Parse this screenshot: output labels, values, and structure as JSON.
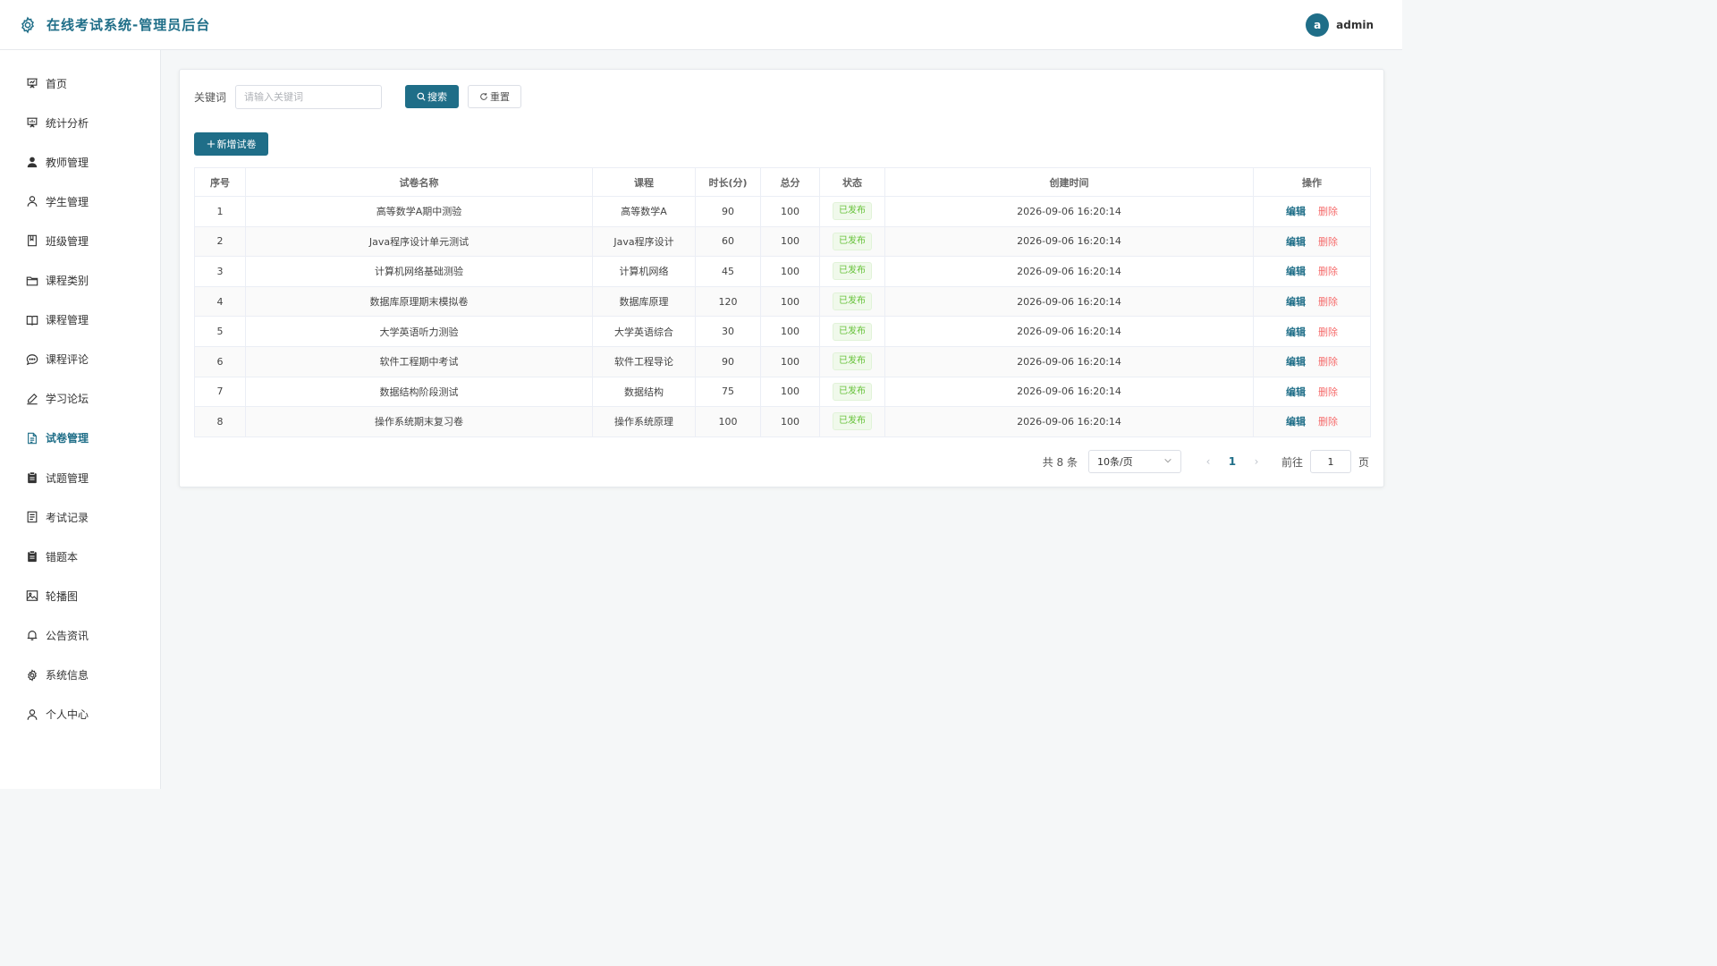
{
  "app": {
    "title": "在线考试系统-管理员后台"
  },
  "user": {
    "initial": "a",
    "name": "admin"
  },
  "sidebar": {
    "active": 9,
    "items": [
      {
        "label": "首页",
        "icon": "presentation-icon"
      },
      {
        "label": "统计分析",
        "icon": "chart-board-icon"
      },
      {
        "label": "教师管理",
        "icon": "user-filled-icon"
      },
      {
        "label": "学生管理",
        "icon": "user-icon"
      },
      {
        "label": "班级管理",
        "icon": "notebook-icon"
      },
      {
        "label": "课程类别",
        "icon": "folder-icon"
      },
      {
        "label": "课程管理",
        "icon": "book-icon"
      },
      {
        "label": "课程评论",
        "icon": "chat-icon"
      },
      {
        "label": "学习论坛",
        "icon": "edit-pen-icon"
      },
      {
        "label": "试卷管理",
        "icon": "document-icon"
      },
      {
        "label": "试题管理",
        "icon": "clipboard-icon"
      },
      {
        "label": "考试记录",
        "icon": "tickets-icon"
      },
      {
        "label": "错题本",
        "icon": "clipboard-icon"
      },
      {
        "label": "轮播图",
        "icon": "picture-icon"
      },
      {
        "label": "公告资讯",
        "icon": "bell-icon"
      },
      {
        "label": "系统信息",
        "icon": "gear-icon"
      },
      {
        "label": "个人中心",
        "icon": "user-icon"
      }
    ]
  },
  "search": {
    "label": "关键词",
    "placeholder": "请输入关键词",
    "value": "",
    "search_label": "搜索",
    "reset_label": "重置"
  },
  "toolbar": {
    "add_label": "新增试卷"
  },
  "table": {
    "columns": [
      "序号",
      "试卷名称",
      "课程",
      "时长(分)",
      "总分",
      "状态",
      "创建时间",
      "操作"
    ],
    "edit_label": "编辑",
    "delete_label": "删除",
    "rows": [
      {
        "no": "1",
        "name": "高等数学A期中测验",
        "course": "高等数学A",
        "duration": "90",
        "score": "100",
        "status": "已发布",
        "created": "2026-09-06 16:20:14"
      },
      {
        "no": "2",
        "name": "Java程序设计单元测试",
        "course": "Java程序设计",
        "duration": "60",
        "score": "100",
        "status": "已发布",
        "created": "2026-09-06 16:20:14"
      },
      {
        "no": "3",
        "name": "计算机网络基础测验",
        "course": "计算机网络",
        "duration": "45",
        "score": "100",
        "status": "已发布",
        "created": "2026-09-06 16:20:14"
      },
      {
        "no": "4",
        "name": "数据库原理期末模拟卷",
        "course": "数据库原理",
        "duration": "120",
        "score": "100",
        "status": "已发布",
        "created": "2026-09-06 16:20:14"
      },
      {
        "no": "5",
        "name": "大学英语听力测验",
        "course": "大学英语综合",
        "duration": "30",
        "score": "100",
        "status": "已发布",
        "created": "2026-09-06 16:20:14"
      },
      {
        "no": "6",
        "name": "软件工程期中考试",
        "course": "软件工程导论",
        "duration": "90",
        "score": "100",
        "status": "已发布",
        "created": "2026-09-06 16:20:14"
      },
      {
        "no": "7",
        "name": "数据结构阶段测试",
        "course": "数据结构",
        "duration": "75",
        "score": "100",
        "status": "已发布",
        "created": "2026-09-06 16:20:14"
      },
      {
        "no": "8",
        "name": "操作系统期末复习卷",
        "course": "操作系统原理",
        "duration": "100",
        "score": "100",
        "status": "已发布",
        "created": "2026-09-06 16:20:14"
      }
    ]
  },
  "pagination": {
    "total_text": "共 8 条",
    "page_size": "10条/页",
    "current_page": "1",
    "goto_label": "前往",
    "goto_value": "1",
    "page_unit": "页"
  },
  "colors": {
    "primary": "#1f6e88",
    "danger": "#f56c6c",
    "success": "#67c23a"
  }
}
